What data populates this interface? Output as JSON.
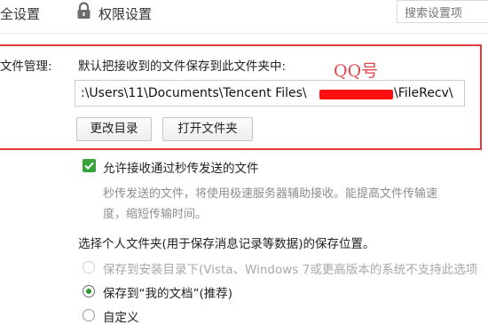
{
  "tabs": [
    {
      "label": "全设置"
    },
    {
      "label": "权限设置",
      "icon": "lock-icon"
    }
  ],
  "search": {
    "placeholder": "搜索设置项"
  },
  "file_management": {
    "label": "文件管理:",
    "description": "默认把接收到的文件保存到此文件夹中:",
    "annotation": "QQ号",
    "path_prefix": ":\\Users\\11\\Documents\\Tencent Files\\",
    "path_suffix": "\\FileRecv\\",
    "buttons": {
      "change_dir": "更改目录",
      "open_folder": "打开文件夹"
    }
  },
  "flash_transfer": {
    "checkbox_label": "允许接收通过秒传发送的文件",
    "checked": true,
    "hint_line1": "秒传发送的文件，将使用极速服务器辅助接收。能提高文件传输速",
    "hint_line2": "度，缩短传输时间。"
  },
  "personal_folder": {
    "title": "选择个人文件夹(用于保存消息记录等数据)的保存位置。",
    "options": [
      {
        "label": "保存到安装目录下(Vista、Windows 7或更高版本的系统不支持此选项",
        "disabled": true,
        "selected": false
      },
      {
        "label": "保存到“我的文档”(推荐)",
        "disabled": false,
        "selected": true
      },
      {
        "label": "自定义",
        "disabled": false,
        "selected": false
      }
    ]
  },
  "colors": {
    "accent": "#38a33b",
    "annotation_red": "#e03a3a"
  }
}
